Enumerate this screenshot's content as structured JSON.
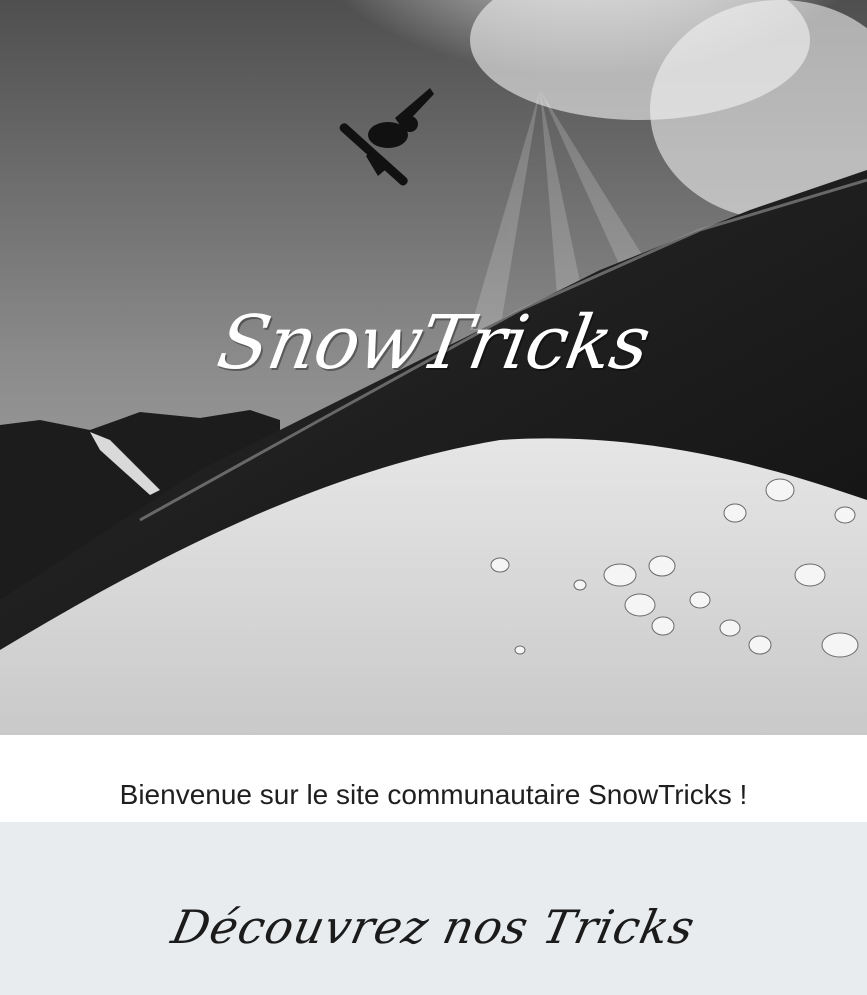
{
  "hero": {
    "title": "SnowTricks",
    "image_alt": "snowboarder-jumping-over-mountain-slope"
  },
  "welcome": {
    "text": "Bienvenue sur le site communautaire SnowTricks !"
  },
  "discover": {
    "title": "Découvrez nos Tricks"
  },
  "colors": {
    "discover_background": "#e9ecef",
    "text_dark": "#1f1f1f",
    "hero_title": "#ffffff"
  }
}
